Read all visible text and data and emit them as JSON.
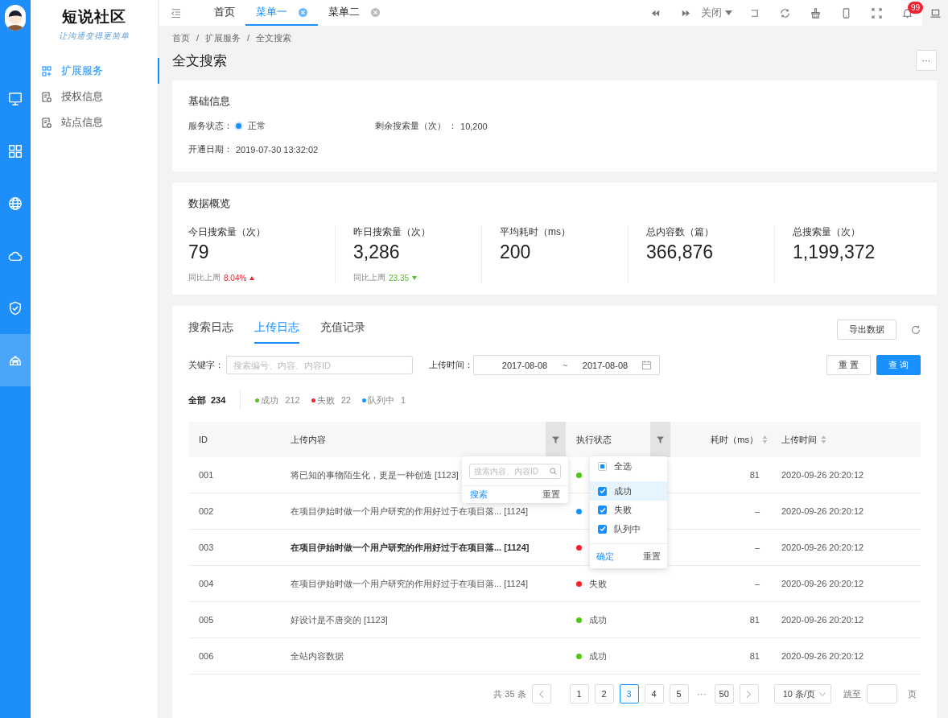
{
  "rail": {
    "items": [
      {
        "selected": false
      },
      {
        "selected": false
      },
      {
        "selected": false
      },
      {
        "selected": false
      },
      {
        "selected": false
      },
      {
        "selected": true
      }
    ]
  },
  "sidebar": {
    "logo": "短说社区",
    "slogan": "让沟通变得更简单",
    "items": [
      {
        "label": "扩展服务",
        "selected": true
      },
      {
        "label": "授权信息",
        "selected": false
      },
      {
        "label": "站点信息",
        "selected": false
      }
    ]
  },
  "topbar": {
    "tabs": [
      {
        "label": "首页",
        "selected": false,
        "closable": false
      },
      {
        "label": "菜单一",
        "selected": true,
        "closable": true
      },
      {
        "label": "菜单二",
        "selected": false,
        "closable": true
      }
    ],
    "close_menu": "关闭",
    "badge": "99"
  },
  "page": {
    "breadcrumb": [
      "首页",
      "扩展服务",
      "全文搜索"
    ],
    "separator": "/",
    "title": "全文搜索",
    "more": "···"
  },
  "basic_info": {
    "title": "基础信息",
    "status_label": "服务状态：",
    "status_value": "正常",
    "remaining_label": "剩余搜索量（次）  ：",
    "remaining_value": "10,200",
    "date_label": "开通日期：",
    "date_value": "2019-07-30 13:32:02"
  },
  "overview": {
    "title": "数据概览",
    "stats": [
      {
        "label": "今日搜索量（次）",
        "value": "79",
        "compare_label": "同比上周",
        "compare_value": "8.04%",
        "kind": "up"
      },
      {
        "label": "昨日搜索量（次）",
        "value": "3,286",
        "compare_label": "同比上周",
        "compare_value": "23.35",
        "kind": "down"
      },
      {
        "label": "平均耗时（ms）",
        "value": "200"
      },
      {
        "label": "总内容数（篇）",
        "value": "366,876"
      },
      {
        "label": "总搜索量（次）",
        "value": "1,199,372"
      }
    ]
  },
  "logs": {
    "tabs": [
      {
        "label": "搜索日志",
        "selected": false
      },
      {
        "label": "上传日志",
        "selected": true
      },
      {
        "label": "充值记录",
        "selected": false
      }
    ],
    "export": "导出数据",
    "keyword_label": "关键字：",
    "keyword_placeholder": "搜索编号、内容、内容ID",
    "date_label": "上传时间：",
    "date_start": "2017-08-08",
    "date_sep": "~",
    "date_end": "2017-08-08",
    "reset": "重 置",
    "query": "查 询",
    "total_label": "全部",
    "total_count": "234",
    "status_counts": [
      {
        "color": "#52c41a",
        "label": "成功",
        "count": "212"
      },
      {
        "color": "#f5222d",
        "label": "失败",
        "count": "22"
      },
      {
        "color": "#1890ff",
        "label": "队列中",
        "count": "1"
      }
    ],
    "columns": [
      {
        "label": "ID"
      },
      {
        "label": "上传内容",
        "filter": true
      },
      {
        "label": "执行状态",
        "filter": true
      },
      {
        "label": "耗时（ms）",
        "sortable": true
      },
      {
        "label": "上传时间",
        "sortable": true
      }
    ],
    "rows": [
      {
        "id": "001",
        "content": "将已知的事物陌生化，更是一种创造 [1123]",
        "emphasized": false,
        "color": "#52c41a",
        "duration": "81",
        "time": "2020-09-26 20:20:12"
      },
      {
        "id": "002",
        "content": "在项目伊始时做一个用户研究的作用好过于在项目落... [1124]",
        "emphasized": false,
        "color": "#1890ff",
        "duration": "–",
        "time": "2020-09-26 20:20:12"
      },
      {
        "id": "003",
        "content": "在项目伊始时做一个用户研究的作用好过于在项目落... [1124]",
        "emphasized": true,
        "color": "#f5222d",
        "duration": "–",
        "time": "2020-09-26 20:20:12"
      },
      {
        "id": "004",
        "content": "在项目伊始时做一个用户研究的作用好过于在项目落... [1124]",
        "emphasized": false,
        "color": "#f5222d",
        "status_label": "失败",
        "duration": "–",
        "time": "2020-09-26 20:20:12"
      },
      {
        "id": "005",
        "content": "好设计是不唐突的 [1123]",
        "emphasized": false,
        "color": "#52c41a",
        "status_label": "成功",
        "duration": "81",
        "time": "2020-09-26 20:20:12"
      },
      {
        "id": "006",
        "content": "全站内容数据",
        "emphasized": false,
        "color": "#52c41a",
        "status_label": "成功",
        "duration": "81",
        "time": "2020-09-26 20:20:12"
      }
    ],
    "content_filter": {
      "placeholder": "搜索内容、内容ID",
      "confirm": "搜索",
      "reset": "重置"
    },
    "status_filter": {
      "options": [
        {
          "kind": "all",
          "label": "全选",
          "partial": true,
          "hovered": false
        },
        {
          "kind": "item",
          "label": "成功",
          "checked": true,
          "hovered": true
        },
        {
          "kind": "item",
          "label": "失败",
          "checked": true,
          "hovered": false
        },
        {
          "kind": "item",
          "label": "队列中",
          "checked": true,
          "hovered": false
        }
      ],
      "confirm": "确定",
      "reset": "重置"
    },
    "pagination": {
      "total": "共 35 条",
      "pages": [
        {
          "label": "1",
          "selected": false
        },
        {
          "label": "2",
          "selected": false
        },
        {
          "label": "3",
          "selected": true
        },
        {
          "label": "4",
          "selected": false
        },
        {
          "label": "5",
          "selected": false
        },
        {
          "label": "···",
          "kind": "ellipsis"
        },
        {
          "label": "50",
          "selected": false
        }
      ],
      "page_size": "10 条/页",
      "jump_label": "跳至",
      "jump_suffix": "页"
    }
  }
}
